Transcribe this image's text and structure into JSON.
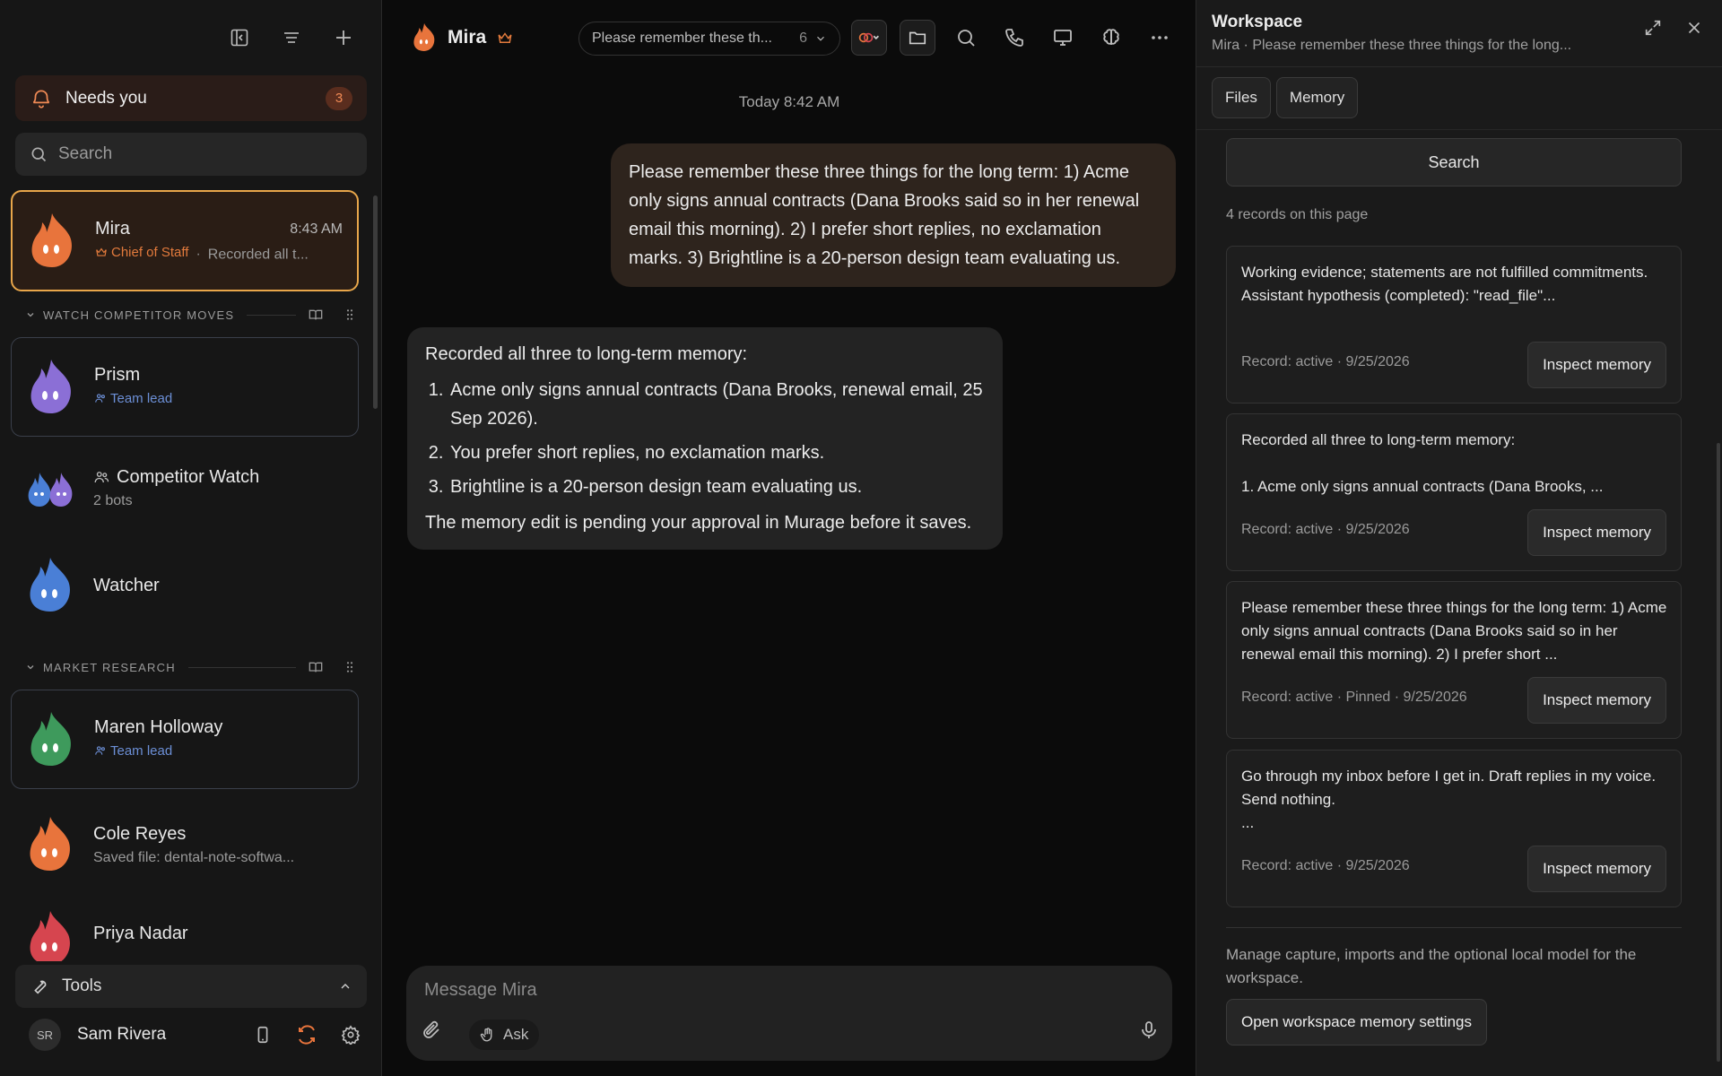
{
  "sidebar": {
    "needs_you": {
      "label": "Needs you",
      "count": "3"
    },
    "search_placeholder": "Search",
    "selected_agent": {
      "name": "Mira",
      "time": "8:43 AM",
      "role": "Chief of Staff",
      "preview": "Recorded all t..."
    },
    "groups": [
      {
        "title": "WATCH COMPETITOR MOVES"
      },
      {
        "title": "MARKET RESEARCH"
      }
    ],
    "agents": [
      {
        "name": "Prism",
        "role": "Team lead",
        "color": "#8b6fd6"
      },
      {
        "name": "Competitor Watch",
        "sub": "2 bots",
        "color": "#4a7fd6"
      },
      {
        "name": "Watcher",
        "color": "#4a7fd6"
      },
      {
        "name": "Maren Holloway",
        "role": "Team lead",
        "color": "#3e9a5c"
      },
      {
        "name": "Cole Reyes",
        "sub": "Saved file: dental-note-softwa...",
        "color": "#e8743c"
      },
      {
        "name": "Priya Nadar",
        "color": "#d6454f"
      }
    ],
    "tools_label": "Tools",
    "user": {
      "initials": "SR",
      "name": "Sam Rivera"
    }
  },
  "chat": {
    "title": "Mira",
    "thread": {
      "label": "Please remember these th...",
      "count": "6"
    },
    "date": "Today 8:42 AM",
    "user_message": "Please remember these three things for the long term: 1) Acme only signs annual contracts (Dana Brooks said so in her renewal email this morning). 2) I prefer short replies, no exclamation marks. 3) Brightline is a 20-person design team evaluating us.",
    "bot_message": {
      "intro": "Recorded all three to long-term memory:",
      "items": [
        "Acme only signs annual contracts (Dana Brooks, renewal email, 25 Sep 2026).",
        "You prefer short replies, no exclamation marks.",
        "Brightline is a 20-person design team evaluating us."
      ],
      "outro": "The memory edit is pending your approval in Murage before it saves."
    },
    "composer": {
      "placeholder": "Message Mira",
      "ask_label": "Ask"
    }
  },
  "workspace": {
    "title": "Workspace",
    "subtitle": "Mira · Please remember these three things for the long...",
    "tabs": [
      "Files",
      "Memory"
    ],
    "search_label": "Search",
    "records_count": "4 records on this page",
    "records": [
      {
        "text": "Working evidence; statements are not fulfilled commitments.\nAssistant hypothesis (completed): \"read_file\"...",
        "meta": "Record: active · 9/25/2026",
        "button": "Inspect memory"
      },
      {
        "text": "Recorded all three to long-term memory:\n\n1. Acme only signs annual contracts (Dana Brooks, ...",
        "meta": "Record: active · 9/25/2026",
        "button": "Inspect memory"
      },
      {
        "text": "Please remember these three things for the long term: 1) Acme only signs annual contracts (Dana Brooks said so in her renewal email this morning). 2) I prefer short ...",
        "meta": "Record: active · Pinned · 9/25/2026",
        "button": "Inspect memory"
      },
      {
        "text": "Go through my inbox before I get in. Draft replies in my voice. Send nothing.\n...",
        "meta": "Record: active · 9/25/2026",
        "button": "Inspect memory"
      }
    ],
    "manage_text": "Manage capture, imports and the optional local model for the workspace.",
    "open_settings": "Open workspace memory settings"
  },
  "colors": {
    "accent": "#e8743c",
    "selected_border": "#e8a64a",
    "role_blue": "#6c8fd6"
  }
}
